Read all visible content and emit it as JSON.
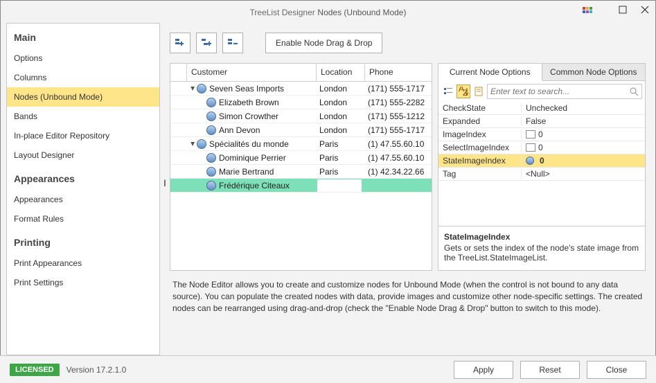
{
  "title_prefix": "TreeList Designer",
  "title_main": "Nodes (Unbound Mode)",
  "sidebar": {
    "sections": [
      {
        "heading": "Main",
        "items": [
          "Options",
          "Columns",
          "Nodes (Unbound Mode)",
          "Bands",
          "In-place Editor Repository",
          "Layout Designer"
        ],
        "active_index": 2
      },
      {
        "heading": "Appearances",
        "items": [
          "Appearances",
          "Format Rules"
        ]
      },
      {
        "heading": "Printing",
        "items": [
          "Print Appearances",
          "Print Settings"
        ]
      }
    ]
  },
  "toolbar": {
    "drag_label": "Enable Node Drag & Drop"
  },
  "grid": {
    "columns": [
      "Customer",
      "Location",
      "Phone"
    ],
    "rows": [
      {
        "level": 0,
        "exp": "▾",
        "name": "Seven Seas Imports",
        "loc": "London",
        "phone": "(171) 555-1717"
      },
      {
        "level": 1,
        "name": "Elizabeth Brown",
        "loc": "London",
        "phone": "(171) 555-2282"
      },
      {
        "level": 1,
        "name": "Simon Crowther",
        "loc": "London",
        "phone": "(171) 555-1212"
      },
      {
        "level": 1,
        "name": "Ann Devon",
        "loc": "London",
        "phone": "(171) 555-1717"
      },
      {
        "level": 0,
        "exp": "▾",
        "name": "Spécialités du monde",
        "loc": "Paris",
        "phone": "(1) 47.55.60.10"
      },
      {
        "level": 1,
        "name": "Dominique Perrier",
        "loc": "Paris",
        "phone": "(1) 47.55.60.10"
      },
      {
        "level": 1,
        "name": "Marie Bertrand",
        "loc": "Paris",
        "phone": "(1) 42.34.22.66"
      },
      {
        "level": 1,
        "name": "Frédérique Citeaux",
        "loc": "",
        "phone": "",
        "editing": true
      }
    ]
  },
  "options_tabs": [
    "Current Node Options",
    "Common Node Options"
  ],
  "options_active_tab": 0,
  "search_placeholder": "Enter text to search...",
  "properties": [
    {
      "name": "CheckState",
      "value": "Unchecked"
    },
    {
      "name": "Expanded",
      "value": "False"
    },
    {
      "name": "ImageIndex",
      "value": "0",
      "swatch": true
    },
    {
      "name": "SelectImageIndex",
      "value": "0",
      "swatch": true
    },
    {
      "name": "StateImageIndex",
      "value": "0",
      "selected": true,
      "icon": true
    },
    {
      "name": "Tag",
      "value": "<Null>"
    }
  ],
  "help": {
    "name": "StateImageIndex",
    "desc": "Gets or sets the index of the node's state image from the TreeList.StateImageList."
  },
  "description": "The Node Editor allows you to create and customize nodes for Unbound Mode (when the control is not bound to any data source). You can populate the created nodes with data, provide images and customize other node-specific settings. The created nodes can be rearranged using drag-and-drop (check the \"Enable Node Drag & Drop\" button to switch to this mode).",
  "footer": {
    "license": "LICENSED",
    "version": "Version 17.2.1.0",
    "buttons": [
      "Apply",
      "Reset",
      "Close"
    ]
  }
}
